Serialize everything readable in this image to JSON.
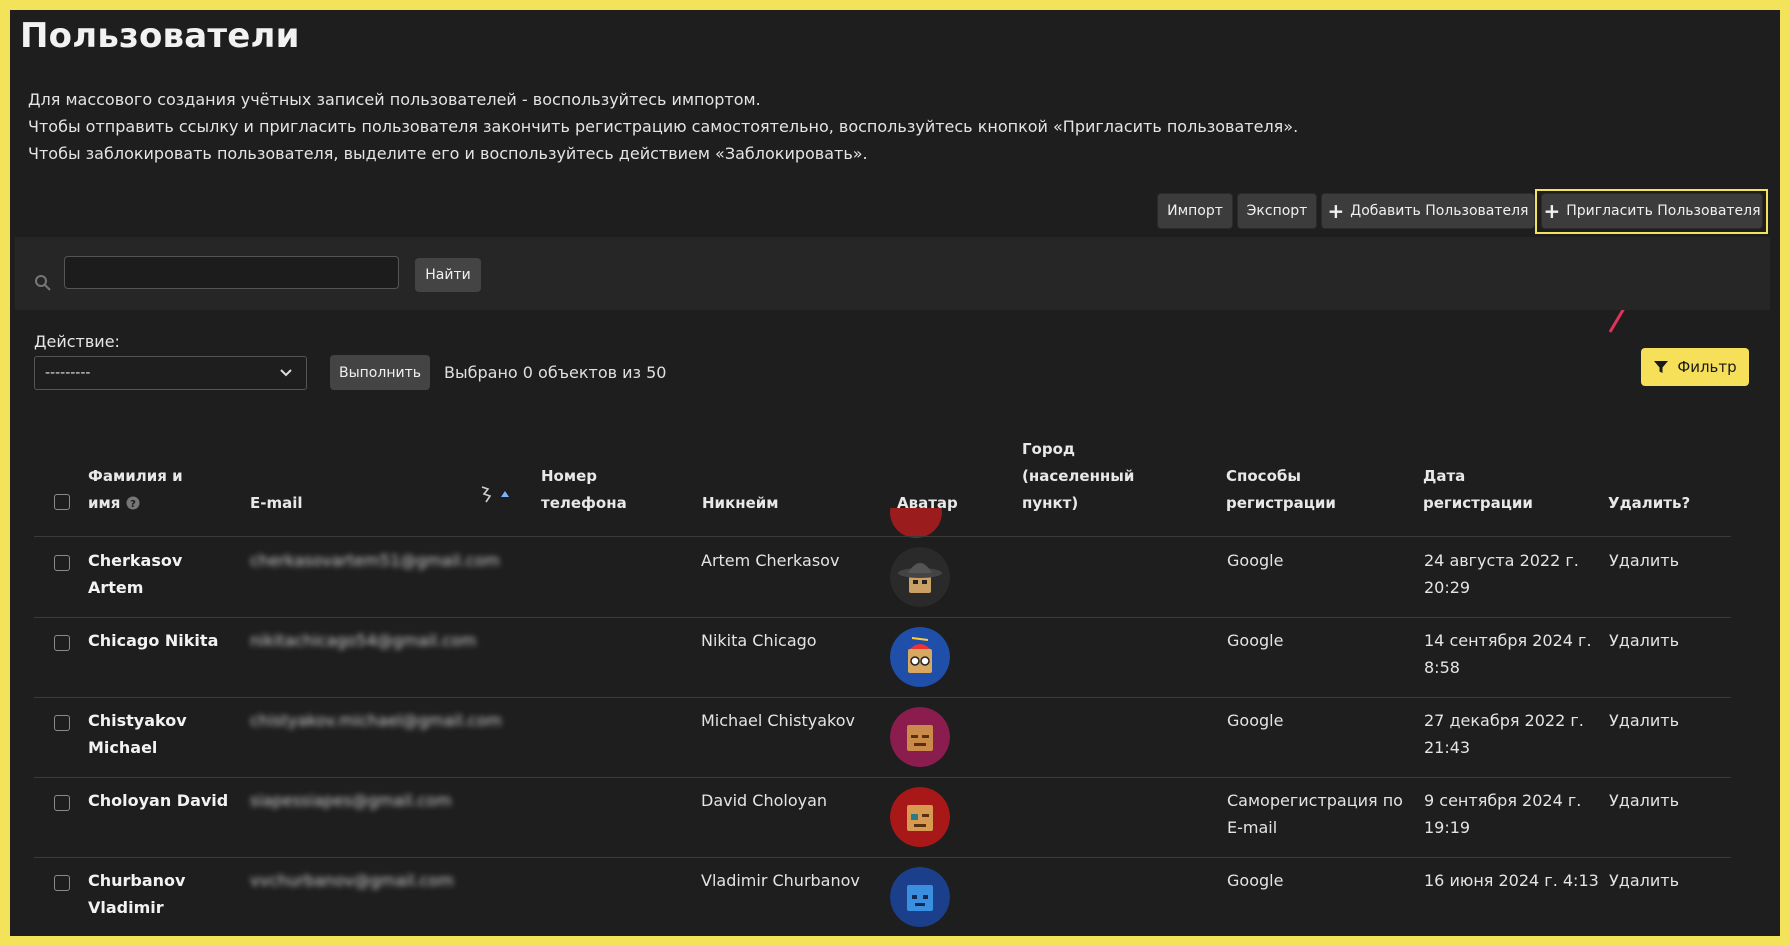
{
  "page": {
    "title": "Пользователи",
    "info_lines": [
      "Для массового создания учётных записей пользователей - воспользуйтесь импортом.",
      "Чтобы отправить ссылку и пригласить пользователя закончить регистрацию самостоятельно, воспользуйтесь кнопкой «Пригласить пользователя».",
      "Чтобы заблокировать пользователя, выделите его и воспользуйтесь действием «Заблокировать»."
    ]
  },
  "toolbar": {
    "import_label": "Импорт",
    "export_label": "Экспорт",
    "add_label": "Добавить Пользователя",
    "invite_label": "Пригласить Пользователя"
  },
  "search": {
    "value": "",
    "button_label": "Найти"
  },
  "actions": {
    "label": "Действие:",
    "selected_option": "---------",
    "run_label": "Выполнить",
    "selected_count_text": "Выбрано 0 объектов из 50",
    "filter_label": "Фильтр"
  },
  "table": {
    "columns": {
      "name": [
        "Фамилия и",
        "имя"
      ],
      "email": [
        "E-mail"
      ],
      "phone": [
        "Номер",
        "телефона"
      ],
      "nickname": [
        "Никнейм"
      ],
      "avatar": [
        "Аватар"
      ],
      "city": [
        "Город",
        "(населенный",
        "пункт)"
      ],
      "methods": [
        "Способы",
        "регистрации"
      ],
      "date": [
        "Дата",
        "регистрации"
      ],
      "delete": [
        "Удалить?"
      ]
    },
    "rows": [
      {
        "name": "Cherkasov Artem",
        "email": "cherkasovartem51@gmail.com",
        "phone": "",
        "nickname": "Artem Cherkasov",
        "avatar": "detective-hat-avatar",
        "city": "",
        "method": "Google",
        "date": "24 августа 2022 г. 20:29",
        "delete_label": "Удалить"
      },
      {
        "name": "Chicago Nikita",
        "email": "nikitachicago54@gmail.com",
        "phone": "",
        "nickname": "Nikita Chicago",
        "avatar": "propeller-cap-avatar",
        "city": "",
        "method": "Google",
        "date": "14 сентября 2024 г. 8:58",
        "delete_label": "Удалить"
      },
      {
        "name": "Chistyakov Michael",
        "email": "chistyakov.michael@gmail.com",
        "phone": "",
        "nickname": "Michael Chistyakov",
        "avatar": "box-face-avatar",
        "city": "",
        "method": "Google",
        "date": "27 декабря 2022 г. 21:43",
        "delete_label": "Удалить"
      },
      {
        "name": "Choloyan David",
        "email": "siapessiapes@gmail.com",
        "phone": "",
        "nickname": "David Choloyan",
        "avatar": "box-face-avatar",
        "city": "",
        "method": "Саморегистрация по E-mail",
        "date": "9 сентября 2024 г. 19:19",
        "delete_label": "Удалить"
      },
      {
        "name": "Churbanov Vladimir",
        "email": "vvchurbanov@gmail.com",
        "phone": "",
        "nickname": "Vladimir Churbanov",
        "avatar": "blue-box-avatar",
        "city": "",
        "method": "Google",
        "date": "16 июня 2024 г. 4:13",
        "delete_label": "Удалить"
      }
    ]
  },
  "colors": {
    "background": "#1e1e1e",
    "frame_border": "#f2e35a",
    "accent_yellow": "#f6e05a",
    "annotation_arrow": "#e0335a",
    "button_bg": "#3c3c3c"
  }
}
